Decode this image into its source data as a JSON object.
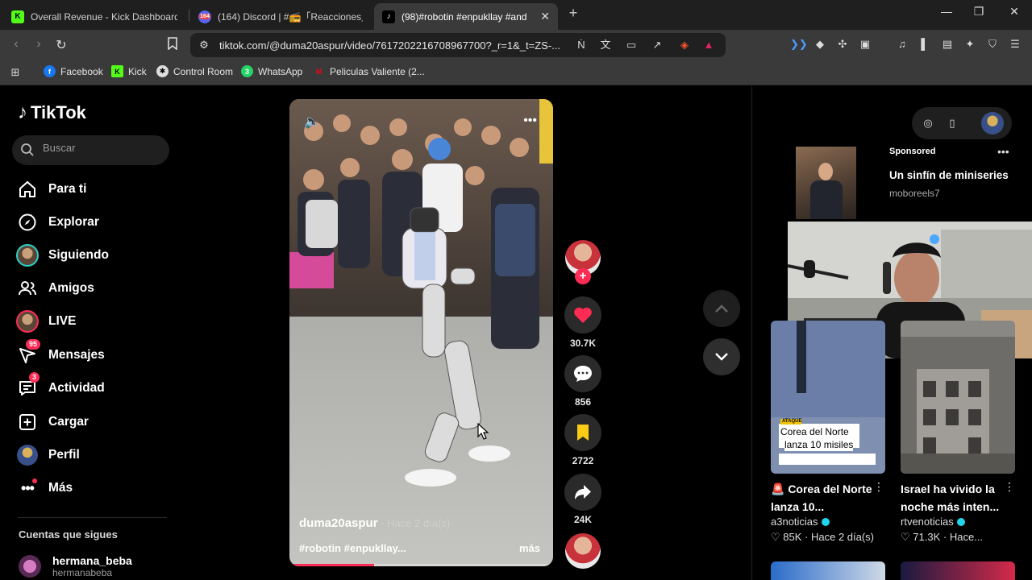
{
  "browser": {
    "tabs": [
      {
        "title": "Overall Revenue - Kick Dashboard",
        "icon": "kick-icon",
        "active": false
      },
      {
        "title": "(164) Discord | #📻「Reacciones」| B",
        "icon": "discord-icon",
        "badge": "164",
        "active": false
      },
      {
        "title": "(98)#robotin #enpukllay #and",
        "icon": "tiktok-icon",
        "active": true
      }
    ],
    "url": "tiktok.com/@duma20aspur/video/7617202216708967700?_r=1&_t=ZS-...",
    "bookmarks": [
      {
        "label": "Facebook",
        "icon": "facebook-icon",
        "color": "#1877f2"
      },
      {
        "label": "Kick",
        "icon": "kick-icon",
        "color": "#53fc18"
      },
      {
        "label": "Control Room",
        "icon": "control-room-icon",
        "color": "#cccccc"
      },
      {
        "label": "WhatsApp",
        "icon": "whatsapp-icon",
        "color": "#25d366"
      },
      {
        "label": "Peliculas Valiente (2...",
        "icon": "peliculas-icon",
        "color": "#e50914"
      }
    ]
  },
  "tiktok": {
    "logo": "TikTok",
    "search_placeholder": "Buscar",
    "nav": [
      {
        "label": "Para ti",
        "icon": "home-icon"
      },
      {
        "label": "Explorar",
        "icon": "compass-icon"
      },
      {
        "label": "Siguiendo",
        "icon": "following-avatar"
      },
      {
        "label": "Amigos",
        "icon": "friends-icon"
      },
      {
        "label": "LIVE",
        "icon": "live-avatar"
      },
      {
        "label": "Mensajes",
        "icon": "messages-icon",
        "badge": "95"
      },
      {
        "label": "Actividad",
        "icon": "activity-icon",
        "badge": "3"
      },
      {
        "label": "Cargar",
        "icon": "upload-icon"
      },
      {
        "label": "Perfil",
        "icon": "profile-avatar"
      },
      {
        "label": "Más",
        "icon": "more-icon"
      }
    ],
    "following_title": "Cuentas que sigues",
    "following": [
      {
        "name": "hermana_beba",
        "handle": "hermanabeba"
      }
    ],
    "video": {
      "author": "duma20aspur",
      "time": " · Hace 2 día(s)",
      "tags": "#robotin #enpukllay...",
      "more": "más",
      "progress": 0.32
    },
    "actions": {
      "likes": "30.7K",
      "comments": "856",
      "saves": "2722",
      "shares": "24K"
    },
    "sponsored": {
      "label": "Sponsored",
      "title": "Un sinfín de miniseries",
      "account": "moboreels7"
    },
    "cards": [
      {
        "title": "🚨 Corea del Norte lanza 10...",
        "user": "a3noticias",
        "likes": "85K",
        "time": "Hace 2 día(s)",
        "overlay_line1": "Corea del Norte",
        "overlay_line2": "lanza 10 misiles",
        "tag": "ATAQUE"
      },
      {
        "title": "Israel ha vivido la noche más inten...",
        "user": "rtvenoticias",
        "likes": "71.3K",
        "time": "Hace..."
      }
    ]
  },
  "colors": {
    "accent": "#fe2c55",
    "teal": "#20d5ec",
    "bg": "#000000"
  }
}
